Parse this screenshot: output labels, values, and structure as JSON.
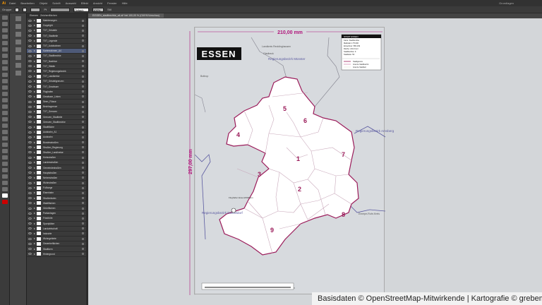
{
  "app": {
    "logo": "Ai",
    "menu": [
      "Datei",
      "Bearbeiten",
      "Objekt",
      "Schrift",
      "Auswahl",
      "Effekt",
      "Ansicht",
      "Fenster",
      "Hilfe"
    ],
    "workspace": "Grundlagen"
  },
  "control_bar": {
    "selection": "Gruppe",
    "stroke": "Pt",
    "style": "Einfach",
    "opacity": "100%",
    "label_style": "Stil"
  },
  "document_tab": "EISSEN_stadtbezirke_a4.ai* bei 100,00 % (CMYK/Vorschau)",
  "layers_panel": {
    "tabs": [
      "Ebenen",
      "Zeichenflächen"
    ],
    "layers": [
      "Markierungen",
      "Copyright",
      "TXT_Ortsteile",
      "TXT_Stadtteile",
      "TXT_Legende",
      "TXT_Autobahnen",
      "Kartenrahmen_A4",
      "TXT_Stadtbezirke",
      "TXT_Nachbar",
      "TXT_Städte",
      "TXT_Regierungsbezirk",
      "TXT_Landkreise",
      "TXT_Ortsteilgrenzen",
      "TXT_Gewässer",
      "Flughafen",
      "Gewässer_Linien",
      "Seen_Flüsse",
      "Bezirksgrenze",
      "TXT_Grenzen",
      "Grenzen_Stadtteile",
      "Grenzen_Stadtbezirke",
      "Stadtfläche",
      "Autobahn_A1",
      "Autobahn",
      "Bundesstraßen",
      "Straßen_Regierung",
      "Straßen_Landkreise",
      "Kreisstraßen",
      "Landesstraßen",
      "Gemeindestraßen",
      "Hauptstraßen",
      "Nebenstraßen",
      "Wohnstraßen",
      "Fußwege",
      "Eisenbahn",
      "Straßenbahn",
      "Waldflächen",
      "Grünflächen",
      "Parkanlagen",
      "Friedhöfe",
      "Sportplätze",
      "Landwirtschaft",
      "Industrie",
      "Wohngebiete",
      "Gewerbeflächen",
      "Stadtkern",
      "Hintergrund"
    ],
    "selected_index": 6
  },
  "map": {
    "title": "ESSEN",
    "width_label": "210,00 mm",
    "height_label": "297,00 mm",
    "districts": [
      "1",
      "2",
      "3",
      "4",
      "5",
      "6",
      "7",
      "8",
      "9"
    ],
    "neighbours": {
      "north_county": "Landkreis Recklinghausen",
      "north_region": "Regierungsbezirk Münster",
      "east_region": "Regierungsbezirk Arnsberg",
      "west_region": "Regierungsbezirk Düsseldorf",
      "south_county": "Landkreis Mettmann",
      "east_city": "Ennepe-Ruhr-Kreis",
      "north_city": "Gladbeck",
      "west_city": "Bottrop"
    },
    "legend": {
      "title": "STADT ESSEN",
      "lines": [
        "Karte: Stadtbezirke",
        "Maßstab 1:75.000",
        "Einwohner: 583.109",
        "Fläche: 210,3 km²",
        "Stadtbezirke: 9",
        "Stadtteile: 50"
      ],
      "items": [
        "Stadtgrenze",
        "Grenze Stadtbezirk",
        "Grenze Stadtteil"
      ]
    },
    "airport_label": "Flughafen Essen/Mülheim",
    "colors": {
      "border": "#9b1b5a",
      "district_fill": "#ffffff",
      "background": "#d7dade",
      "district_line": "#c9a9bb"
    }
  },
  "caption": "Basisdaten © OpenStreetMap-Mitwirkende | Kartografie © grebemaps.de"
}
